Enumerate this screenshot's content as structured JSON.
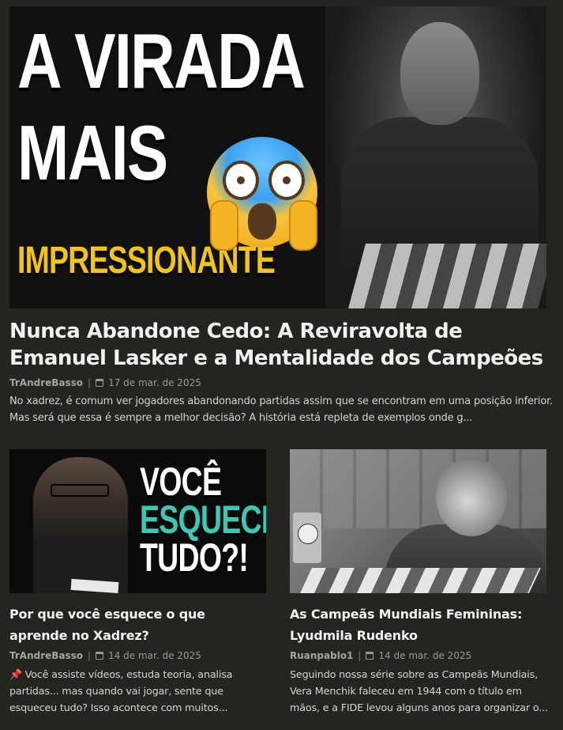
{
  "featured": {
    "thumbnail": {
      "line1": "A VIRADA",
      "line2": "MAIS",
      "line3": "IMPRESSIONANTE",
      "emoji": "screaming-face-emoji"
    },
    "title": "Nunca Abandone Cedo: A Reviravolta de Emanuel Lasker e a Mentalidade dos Campeões",
    "author": "TrAndreBasso",
    "date": "17 de mar. de 2025",
    "excerpt": "No xadrez, é comum ver jogadores abandonando partidas assim que se encontram em uma posição inferior. Mas será que essa é sempre a melhor decisão? A história está repleta de exemplos onde g..."
  },
  "posts": [
    {
      "thumbnail": {
        "line1": "VOCÊ",
        "line2": "ESQUECE",
        "line3": "TUDO?!"
      },
      "title": "Por que você esquece o que aprende no Xadrez?",
      "author": "TrAndreBasso",
      "date": "14 de mar. de 2025",
      "excerpt_icon": "📌",
      "excerpt": "Você assiste vídeos, estuda teoria, analisa partidas... mas quando vai jogar, sente que esqueceu tudo? Isso acontece com muitos..."
    },
    {
      "title": "As Campeãs Mundiais Femininas: Lyudmila Rudenko",
      "author": "Ruanpablo1",
      "date": "14 de mar. de 2025",
      "excerpt": "Seguindo nossa série sobre as Campeãs Mundiais, Vera Menchik faleceu em 1944 com o título em mãos, e a FIDE levou alguns anos para organizar o..."
    }
  ],
  "colors": {
    "background": "#262421",
    "accent_yellow": "#f2c417",
    "accent_teal": "#3fc7b3"
  },
  "icons": [
    "calendar-icon",
    "pin-icon"
  ]
}
